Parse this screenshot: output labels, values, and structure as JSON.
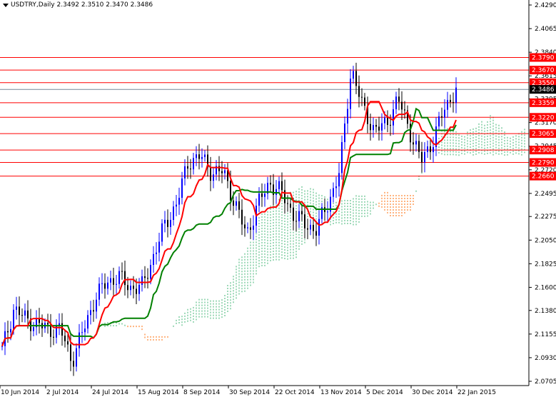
{
  "header": {
    "symbol_tf": "USDTRY,Daily",
    "ohlc": "2.3492 2.3510 2.3470 2.3486"
  },
  "chart_data": {
    "type": "candlestick",
    "title": "USDTRY,Daily",
    "ylim": [
      2.0705,
      2.429
    ],
    "y_ticks": [
      "2.4290",
      "2.4065",
      "2.3840",
      "2.3615",
      "2.3395",
      "2.3170",
      "2.2945",
      "2.2720",
      "2.2495",
      "2.2275",
      "2.2050",
      "2.1825",
      "2.1600",
      "2.1380",
      "2.1155",
      "2.0930",
      "2.0705"
    ],
    "x_ticks": [
      "10 Jun 2014",
      "2 Jul 2014",
      "24 Jul 2014",
      "15 Aug 2014",
      "8 Sep 2014",
      "30 Sep 2014",
      "22 Oct 2014",
      "13 Nov 2014",
      "5 Dec 2014",
      "30 Dec 2014",
      "22 Jan 2015"
    ],
    "x_tick_bars": [
      0,
      16,
      32,
      48,
      64,
      80,
      96,
      112,
      128,
      144,
      160
    ],
    "approx_close_path": [
      2.1,
      2.14,
      2.13,
      2.125,
      2.12,
      2.12,
      2.09,
      2.12,
      2.15,
      2.165,
      2.17,
      2.16,
      2.16,
      2.19,
      2.22,
      2.24,
      2.28,
      2.285,
      2.27,
      2.27,
      2.24,
      2.21,
      2.24,
      2.26,
      2.25,
      2.23,
      2.22,
      2.215,
      2.24,
      2.27,
      2.37,
      2.33,
      2.31,
      2.315,
      2.34,
      2.31,
      2.28,
      2.3,
      2.33,
      2.349
    ],
    "last_price": "2.3486",
    "levels": [
      "2.3790",
      "2.3670",
      "2.3550",
      "2.3359",
      "2.3220",
      "2.3065",
      "2.2908",
      "2.2790",
      "2.2660"
    ],
    "colors": {
      "level": "#ff0000",
      "tenkan": "#ff0000",
      "kijun": "#008000",
      "bull": "#0000ff",
      "bear": "#000000",
      "cloud_up": "#3cb371",
      "cloud_down": "#ff6a00",
      "current": "#000000"
    }
  }
}
